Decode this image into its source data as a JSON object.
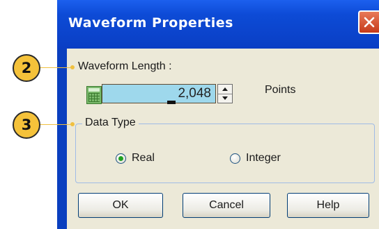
{
  "window": {
    "title": "Waveform Properties"
  },
  "length": {
    "label": "Waveform Length :",
    "value": "2,048",
    "unit": "Points"
  },
  "data_type": {
    "legend": "Data Type",
    "options": [
      {
        "label": "Real",
        "selected": true
      },
      {
        "label": "Integer",
        "selected": false
      }
    ]
  },
  "buttons": {
    "ok": "OK",
    "cancel": "Cancel",
    "help": "Help"
  },
  "callouts": [
    "2",
    "3"
  ],
  "colors": {
    "titlebar": "#0a3ec4",
    "dialog_bg": "#ece9d8",
    "callout": "#f5c23a",
    "input_bg": "#9ed8ec"
  },
  "icons": [
    "close-icon",
    "calculator-icon",
    "spin-up-icon",
    "spin-down-icon"
  ]
}
